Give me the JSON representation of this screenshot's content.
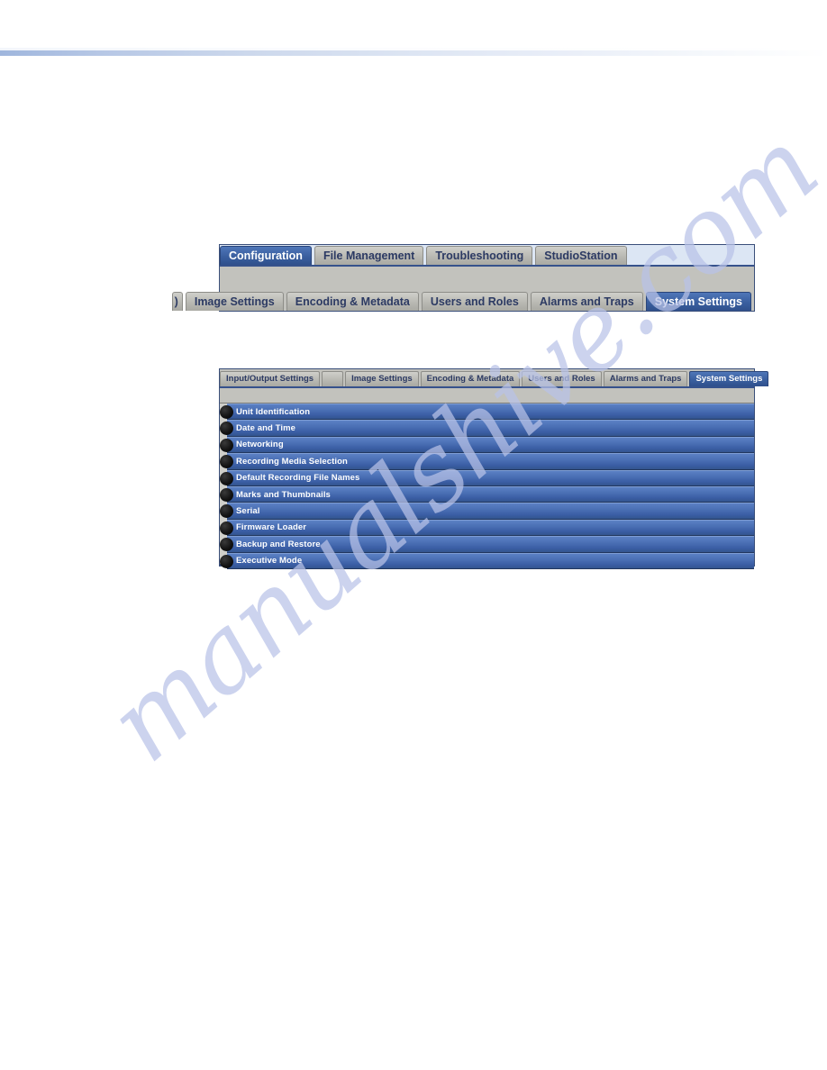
{
  "page": {
    "watermark": "manualshive.com",
    "rule_color": "#9fb6dd"
  },
  "figure_primary_tabs": {
    "row1": [
      {
        "label": "Configuration",
        "active": true
      },
      {
        "label": "File Management",
        "active": false
      },
      {
        "label": "Troubleshooting",
        "active": false
      },
      {
        "label": "StudioStation",
        "active": false
      }
    ],
    "row2": [
      {
        "label": ")",
        "active": false,
        "partial": true
      },
      {
        "label": "Image Settings",
        "active": false
      },
      {
        "label": "Encoding & Metadata",
        "active": false
      },
      {
        "label": "Users and Roles",
        "active": false
      },
      {
        "label": "Alarms and Traps",
        "active": false
      },
      {
        "label": "System Settings",
        "active": true
      }
    ]
  },
  "figure_settings_panel": {
    "tabs": [
      {
        "label": "Input/Output Settings",
        "active": false
      },
      {
        "label": "",
        "active": false,
        "blank": true
      },
      {
        "label": "Image Settings",
        "active": false
      },
      {
        "label": "Encoding & Metadata",
        "active": false
      },
      {
        "label": "Users and Roles",
        "active": false
      },
      {
        "label": "Alarms and Traps",
        "active": false
      },
      {
        "label": "System Settings",
        "active": true
      }
    ],
    "list_items": [
      {
        "label": "Unit Identification"
      },
      {
        "label": "Date and Time"
      },
      {
        "label": "Networking"
      },
      {
        "label": "Recording Media Selection"
      },
      {
        "label": "Default Recording File Names"
      },
      {
        "label": "Marks and Thumbnails"
      },
      {
        "label": "Serial"
      },
      {
        "label": "Firmware Loader"
      },
      {
        "label": "Backup and Restore"
      },
      {
        "label": "Executive Mode"
      }
    ]
  }
}
